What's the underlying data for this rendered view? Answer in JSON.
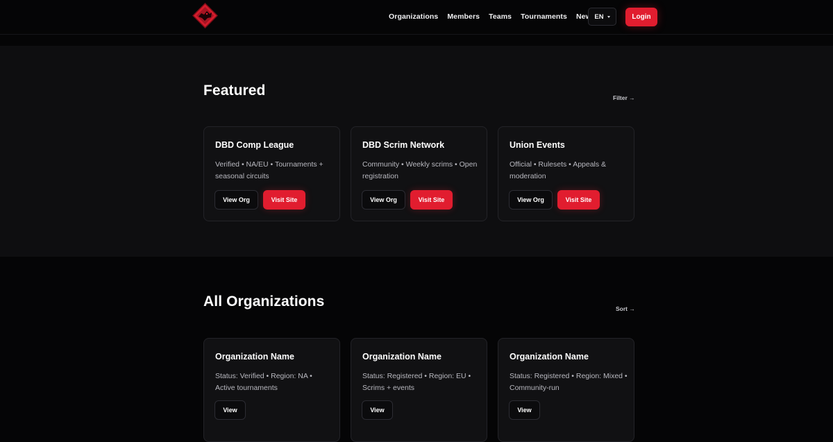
{
  "nav": {
    "items": [
      "Organizations",
      "Members",
      "Teams",
      "Tournaments",
      "News"
    ],
    "language": "EN",
    "login_label": "Login"
  },
  "featured": {
    "title": "Featured",
    "filter_label": "Filter →",
    "cards": [
      {
        "name": "DBD Comp League",
        "description": "Verified • NA/EU • Tournaments + seasonal circuits",
        "view_label": "View Org",
        "visit_label": "Visit Site"
      },
      {
        "name": "DBD Scrim Network",
        "description": "Community • Weekly scrims • Open registration",
        "view_label": "View Org",
        "visit_label": "Visit Site"
      },
      {
        "name": "Union Events",
        "description": "Official • Rulesets • Appeals & moderation",
        "view_label": "View Org",
        "visit_label": "Visit Site"
      }
    ]
  },
  "all": {
    "title": "All Organizations",
    "sort_label": "Sort →",
    "cards": [
      {
        "name": "Organization Name",
        "description": "Status: Verified • Region: NA • Active tournaments",
        "view_label": "View"
      },
      {
        "name": "Organization Name",
        "description": "Status: Registered • Region: EU • Scrims + events",
        "view_label": "View"
      },
      {
        "name": "Organization Name",
        "description": "Status: Registered • Region: Mixed • Community-run",
        "view_label": "View"
      }
    ]
  },
  "colors": {
    "accent": "#e11d2f",
    "background": "#050506",
    "section_bg": "#0e0e10",
    "card_bg": "#111113"
  }
}
